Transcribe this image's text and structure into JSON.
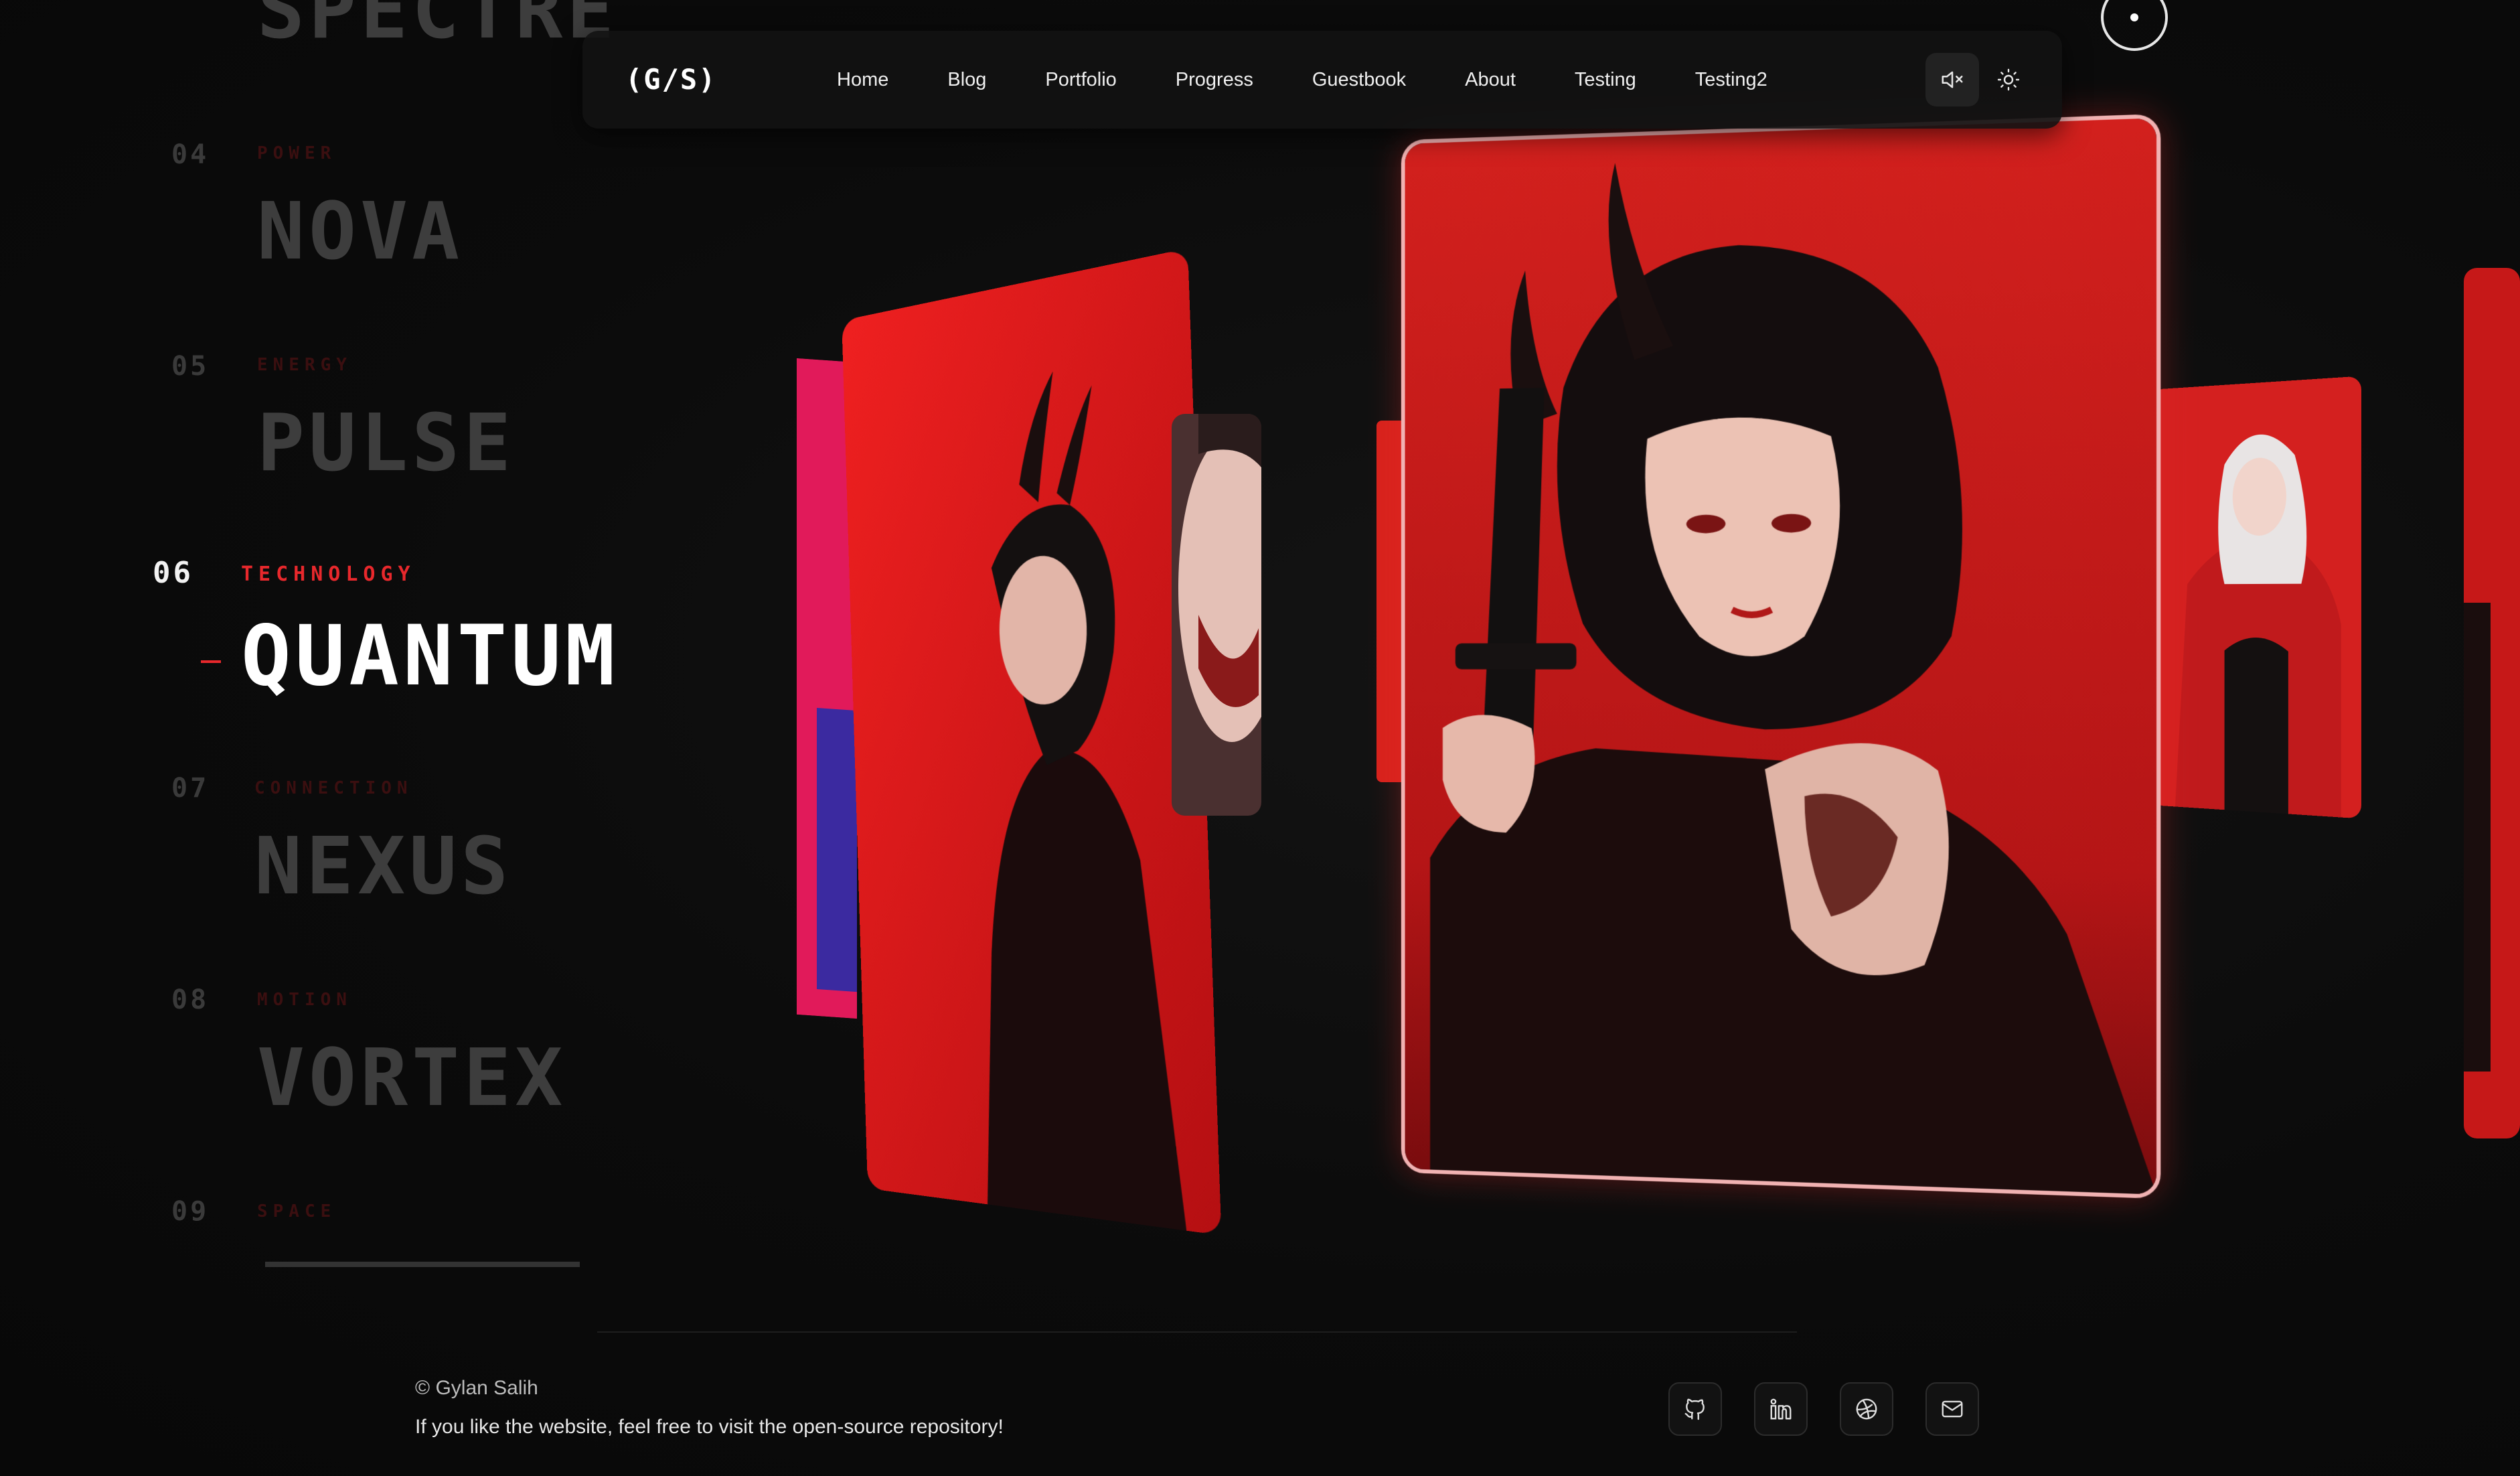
{
  "nav": {
    "logo": "(G/S)",
    "links": [
      "Home",
      "Blog",
      "Portfolio",
      "Progress",
      "Guestbook",
      "About",
      "Testing",
      "Testing2"
    ],
    "sound_icon": "speaker-mute-icon",
    "theme_icon": "sun-icon"
  },
  "list": [
    {
      "num": "",
      "category": "",
      "word": "SPECTRE"
    },
    {
      "num": "04",
      "category": "Power",
      "word": "NOVA"
    },
    {
      "num": "05",
      "category": "Energy",
      "word": "PULSE"
    },
    {
      "num": "06",
      "category": "Technology",
      "word": "QUANTUM"
    },
    {
      "num": "07",
      "category": "Connection",
      "word": "NEXUS"
    },
    {
      "num": "08",
      "category": "Motion",
      "word": "VORTEX"
    },
    {
      "num": "09",
      "category": "Space",
      "word": ""
    }
  ],
  "colors": {
    "accent": "#e8282c",
    "background": "#0a0a0a"
  },
  "footer": {
    "copyright": "© Gylan Salih",
    "repo_text": "If you like the website, feel free to visit the open-source repository!",
    "social_icons": [
      "github-icon",
      "linkedin-icon",
      "dribbble-icon",
      "mail-icon"
    ]
  }
}
